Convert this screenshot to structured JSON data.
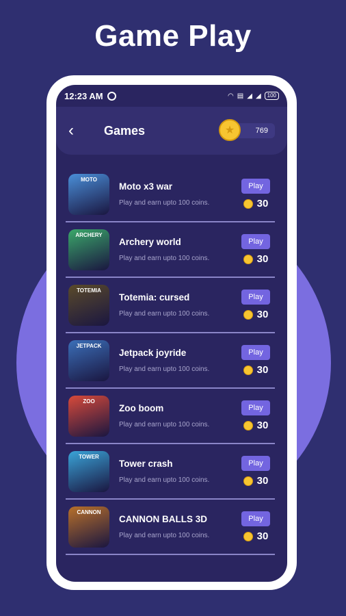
{
  "headline": "Game Play",
  "status_bar": {
    "time": "12:23 AM",
    "battery": "100",
    "signal_icons": [
      "wifi-icon",
      "volte-icon",
      "signal-icon",
      "signal-icon"
    ]
  },
  "header": {
    "title": "Games",
    "coin_balance": "769"
  },
  "games": [
    {
      "title": "Moto x3 war",
      "subtitle": "Play and earn upto 100 coins.",
      "button": "Play",
      "reward": "30",
      "thumb_text": "MOTO",
      "thumb_color": "#4a8fd8"
    },
    {
      "title": "Archery world",
      "subtitle": "Play and earn upto 100 coins.",
      "button": "Play",
      "reward": "30",
      "thumb_text": "ARCHERY",
      "thumb_color": "#3ba86a"
    },
    {
      "title": "Totemia: cursed",
      "subtitle": "Play and earn upto 100 coins.",
      "button": "Play",
      "reward": "30",
      "thumb_text": "TOTEMIA",
      "thumb_color": "#5a4a2a"
    },
    {
      "title": "Jetpack joyride",
      "subtitle": "Play and earn upto 100 coins.",
      "button": "Play",
      "reward": "30",
      "thumb_text": "JETPACK",
      "thumb_color": "#3b6fb8"
    },
    {
      "title": "Zoo boom",
      "subtitle": "Play and earn upto 100 coins.",
      "button": "Play",
      "reward": "30",
      "thumb_text": "ZOO",
      "thumb_color": "#d84a3a"
    },
    {
      "title": "Tower crash",
      "subtitle": "Play and earn upto 100 coins.",
      "button": "Play",
      "reward": "30",
      "thumb_text": "TOWER",
      "thumb_color": "#3aa4d8"
    },
    {
      "title": "CANNON BALLS 3D",
      "subtitle": "Play and earn upto 100 coins.",
      "button": "Play",
      "reward": "30",
      "thumb_text": "CANNON",
      "thumb_color": "#b8702a"
    }
  ]
}
